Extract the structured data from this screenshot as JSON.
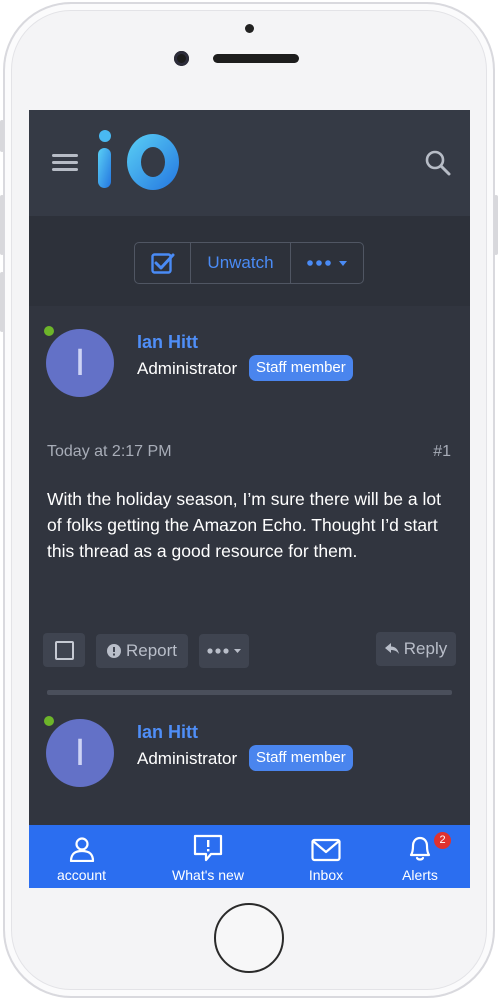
{
  "header": {
    "logo_text": "iO"
  },
  "thread_actions": {
    "unwatch_label": "Unwatch"
  },
  "posts": [
    {
      "username": "Ian Hitt",
      "avatar_letter": "I",
      "user_title": "Administrator",
      "badge": "Staff member",
      "time": "Today at 2:17 PM",
      "post_number": "#1",
      "body": "With the holiday season, I’m sure there will be a lot of folks getting the Amazon Echo. Thought I’d start this thread as a good resource for them.",
      "report_label": "Report",
      "reply_label": "Reply"
    },
    {
      "username": "Ian Hitt",
      "avatar_letter": "I",
      "user_title": "Administrator",
      "badge": "Staff member"
    }
  ],
  "bottom_nav": {
    "items": [
      {
        "label": "account",
        "icon": "person-icon"
      },
      {
        "label": "What's new",
        "icon": "speech-bubble-alert-icon"
      },
      {
        "label": "Inbox",
        "icon": "envelope-icon"
      },
      {
        "label": "Alerts",
        "icon": "bell-icon",
        "badge": "2"
      }
    ]
  },
  "colors": {
    "accent": "#4a8bf5",
    "screen_bg": "#31353f",
    "nav_bg": "#2b6ef0",
    "online": "#6db52a",
    "alert_badge": "#e0322f"
  }
}
